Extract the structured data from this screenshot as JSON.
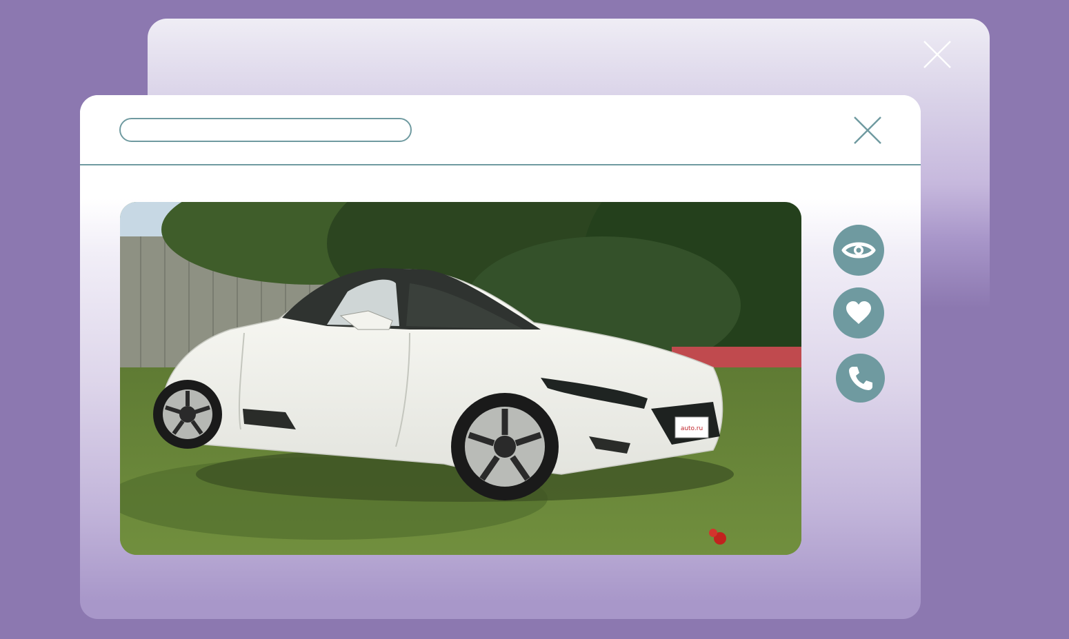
{
  "windows": {
    "back": {
      "close_icon": "close-icon"
    },
    "front": {
      "address_bar": {
        "value": "",
        "placeholder": ""
      },
      "close_icon": "close-icon",
      "photo": {
        "license_plate": "auto.ru"
      },
      "actions": [
        {
          "name": "view",
          "icon": "eye-icon"
        },
        {
          "name": "favorite",
          "icon": "heart-icon"
        },
        {
          "name": "call",
          "icon": "phone-icon"
        }
      ]
    }
  },
  "colors": {
    "background": "#8c78b0",
    "accent": "#6f9aa0",
    "window": "#ffffff"
  }
}
